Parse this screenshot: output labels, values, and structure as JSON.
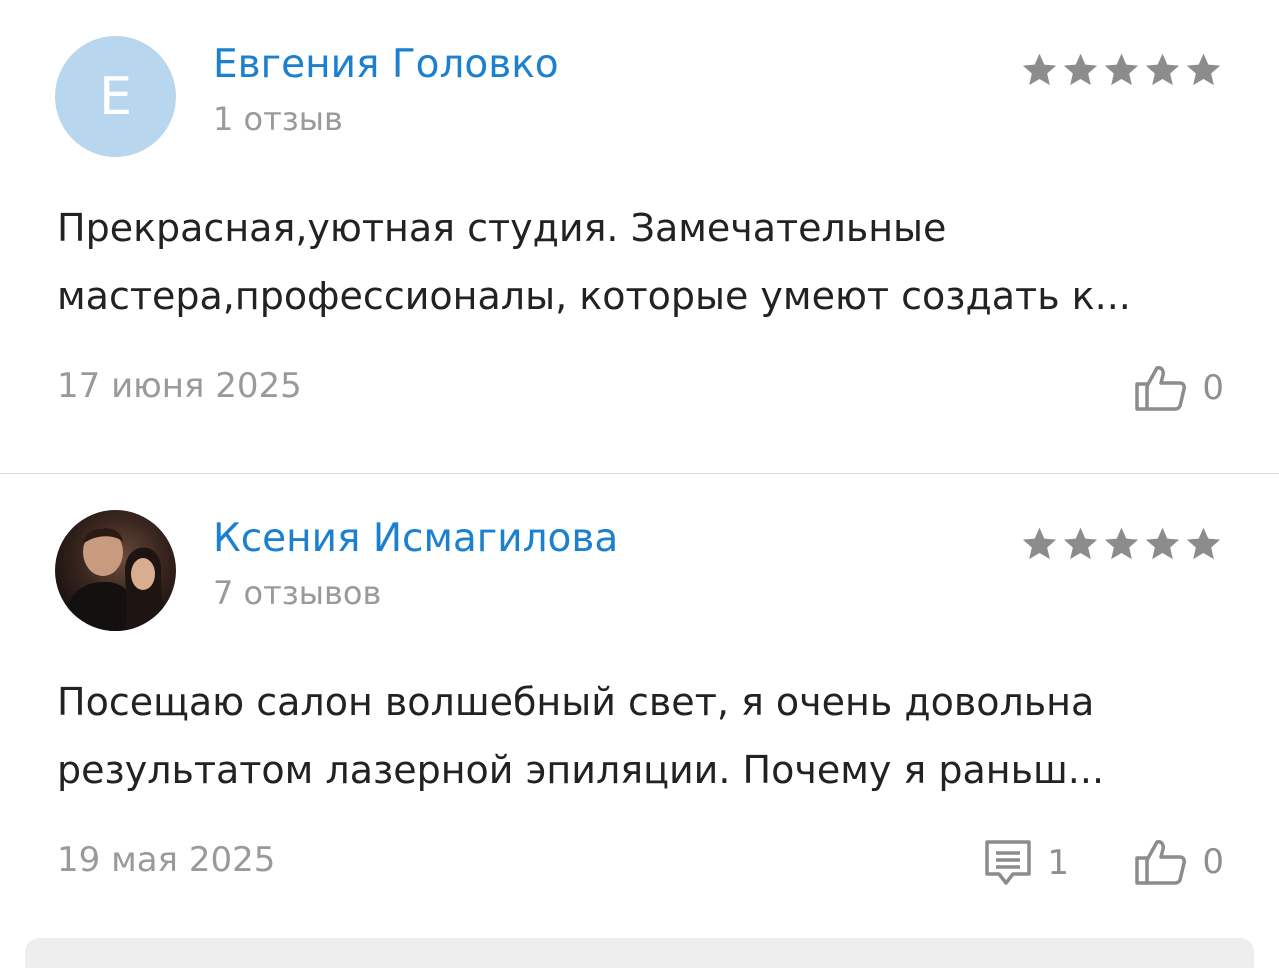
{
  "reviews": [
    {
      "author": "Евгения Головко",
      "avatar_letter": "Е",
      "review_count": "1 отзыв",
      "rating": 5,
      "text_lines": [
        "Прекрасная,уютная студия. Замечательные",
        "мастера,профессионалы, которые умеют создать к..."
      ],
      "date": "17 июня 2025",
      "likes": "0"
    },
    {
      "author": "Ксения Исмагилова",
      "avatar_icon": "user-photo",
      "review_count": "7 отзывов",
      "rating": 5,
      "text_lines": [
        "Посещаю салон волшебный свет, я очень довольна",
        "результатом лазерной эпиляции. Почему я раньш..."
      ],
      "date": "19 мая 2025",
      "comments": "1",
      "likes": "0"
    }
  ],
  "colors": {
    "author_link": "#1a80cf",
    "muted": "#9a9a9a",
    "star": "#8c8c8c",
    "avatar_bg": "#b9d6ef"
  },
  "icons": {
    "star": "star-icon",
    "like": "thumbs-up-icon",
    "comment": "comment-icon"
  }
}
